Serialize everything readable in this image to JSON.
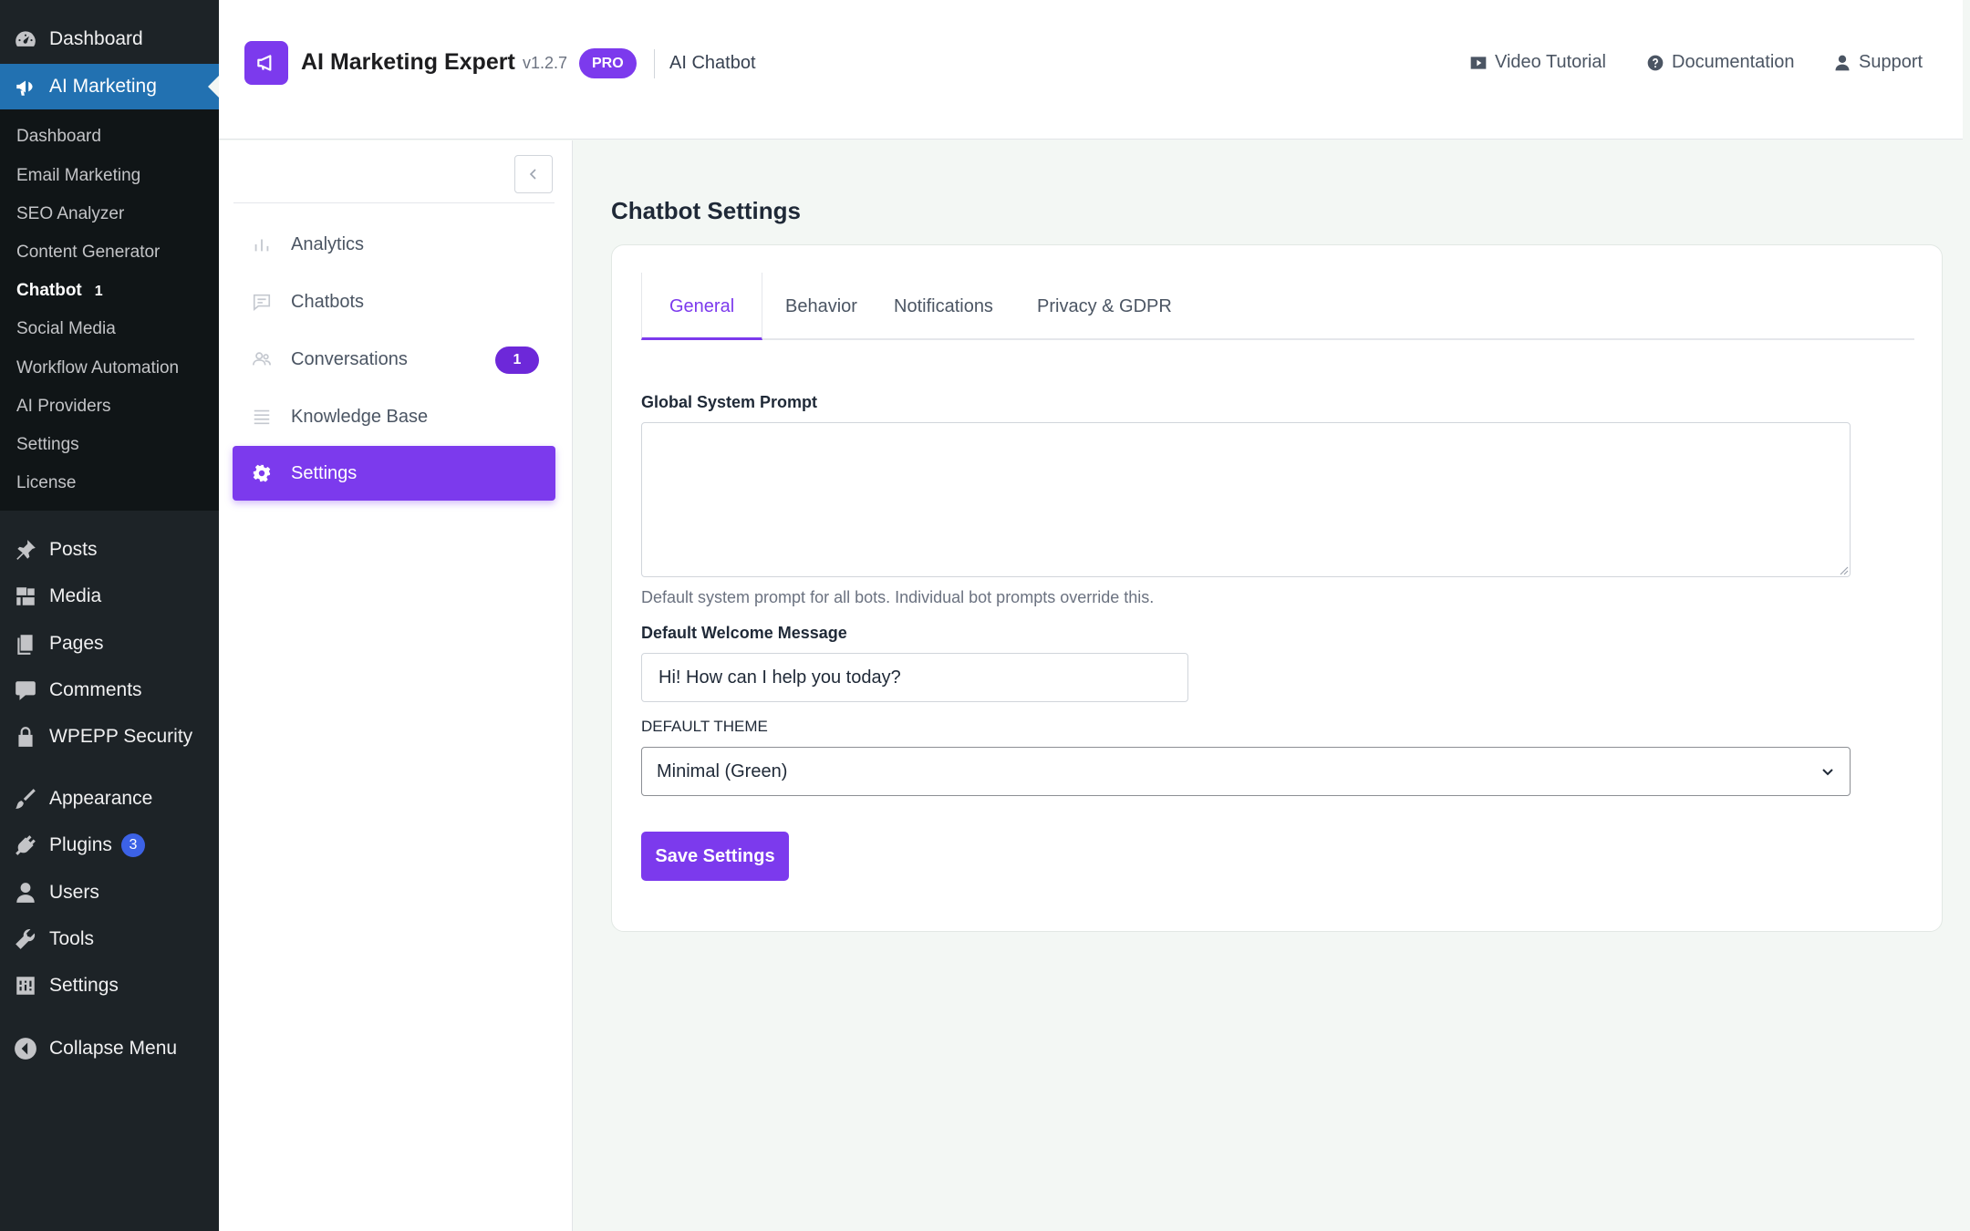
{
  "wp_menu": {
    "dashboard": "Dashboard",
    "ai_marketing": "AI Marketing",
    "submenu": [
      {
        "label": "Dashboard"
      },
      {
        "label": "Email Marketing"
      },
      {
        "label": "SEO Analyzer"
      },
      {
        "label": "Content Generator"
      },
      {
        "label": "Chatbot",
        "count": "1"
      },
      {
        "label": "Social Media"
      },
      {
        "label": "Workflow Automation"
      },
      {
        "label": "AI Providers"
      },
      {
        "label": "Settings"
      },
      {
        "label": "License"
      }
    ],
    "posts": "Posts",
    "media": "Media",
    "pages": "Pages",
    "comments": "Comments",
    "wpepp_security": "WPEPP Security",
    "appearance": "Appearance",
    "plugins": "Plugins",
    "plugins_badge": "3",
    "users": "Users",
    "tools": "Tools",
    "settings": "Settings",
    "collapse": "Collapse Menu"
  },
  "header": {
    "title": "AI Marketing Expert",
    "version": "v1.2.7",
    "badge": "PRO",
    "section": "AI Chatbot",
    "links": {
      "video": "Video Tutorial",
      "docs": "Documentation",
      "support": "Support"
    }
  },
  "plugin_nav": {
    "items": [
      {
        "label": "Analytics"
      },
      {
        "label": "Chatbots"
      },
      {
        "label": "Conversations",
        "count": "1"
      },
      {
        "label": "Knowledge Base"
      },
      {
        "label": "Settings"
      }
    ]
  },
  "main": {
    "title": "Chatbot Settings",
    "tabs": [
      "General",
      "Behavior",
      "Notifications",
      "Privacy & GDPR"
    ],
    "active_tab": "General",
    "prompt_label": "Global System Prompt",
    "prompt_value": "",
    "prompt_help": "Default system prompt for all bots. Individual bot prompts override this.",
    "welcome_label": "Default Welcome Message",
    "welcome_value": "Hi! How can I help you today?",
    "theme_label": "DEFAULT THEME",
    "theme_value": "Minimal (Green)",
    "save_label": "Save Settings"
  },
  "colors": {
    "accent": "#7c3aed",
    "wp_active": "#2271b1",
    "wp_sidebar": "#1d2327"
  }
}
